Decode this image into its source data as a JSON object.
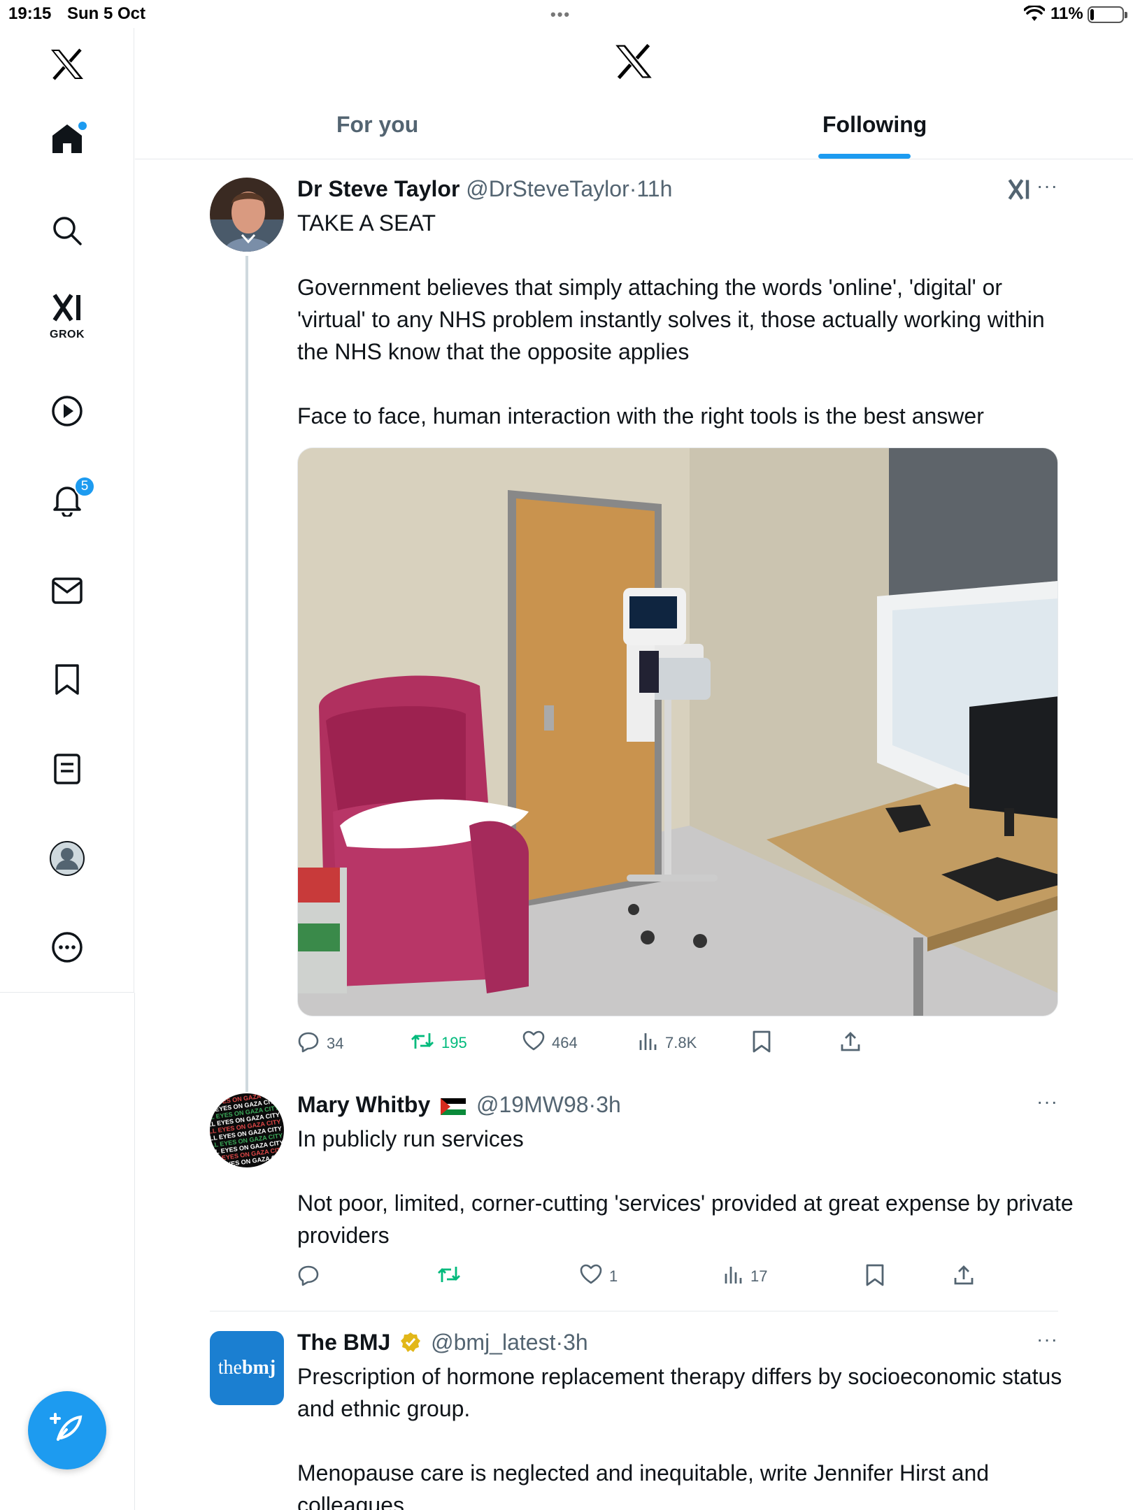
{
  "status_bar": {
    "time": "19:15",
    "date": "Sun 5 Oct",
    "battery": "11%",
    "battery_level": 0.11
  },
  "sidebar": {
    "items": [
      {
        "name": "home",
        "has_dot": true
      },
      {
        "name": "search"
      },
      {
        "name": "grok",
        "label": "GROK"
      },
      {
        "name": "video"
      },
      {
        "name": "notifications",
        "badge": "5"
      },
      {
        "name": "messages"
      },
      {
        "name": "bookmarks"
      },
      {
        "name": "lists"
      },
      {
        "name": "profile"
      },
      {
        "name": "more"
      }
    ]
  },
  "header": {
    "tabs": [
      {
        "label": "For you",
        "active": false
      },
      {
        "label": "Following",
        "active": true
      }
    ]
  },
  "tweets": [
    {
      "name": "Dr Steve Taylor",
      "handle": "@DrSteveTaylor",
      "time": "11h",
      "text": "TAKE A SEAT\n\nGovernment believes that simply attaching the words 'online', 'digital' or 'virtual' to any NHS problem instantly solves it, those actually working within the NHS know that the opposite applies\n\nFace to face, human interaction with the right tools is the best answer",
      "stats": {
        "replies": "34",
        "reposts": "195",
        "likes": "464",
        "views": "7.8K"
      }
    },
    {
      "name": "Mary Whitby",
      "handle": "@19MW98",
      "time": "3h",
      "avatar_text": "ALL EYES ON GAZA CITY",
      "text": "In publicly run services\n\nNot poor, limited, corner-cutting 'services' provided at great expense by private providers",
      "stats": {
        "replies": "",
        "reposts": "",
        "likes": "1",
        "views": "17"
      }
    },
    {
      "name": "The BMJ",
      "handle": "@bmj_latest",
      "time": "3h",
      "avatar_text_the": "the",
      "avatar_text_bmj": "bmj",
      "verified": true,
      "text": "Prescription of hormone replacement therapy differs by socioeconomic status and ethnic group.\n\nMenopause care is neglected and inequitable, write Jennifer Hirst and colleagues"
    }
  ],
  "colors": {
    "accent": "#1d9bf0",
    "text": "#0f1419",
    "secondary": "#536471",
    "repost_green": "#00ba7c",
    "verified_gold": "#e2b719",
    "chair": "#b0305f"
  }
}
